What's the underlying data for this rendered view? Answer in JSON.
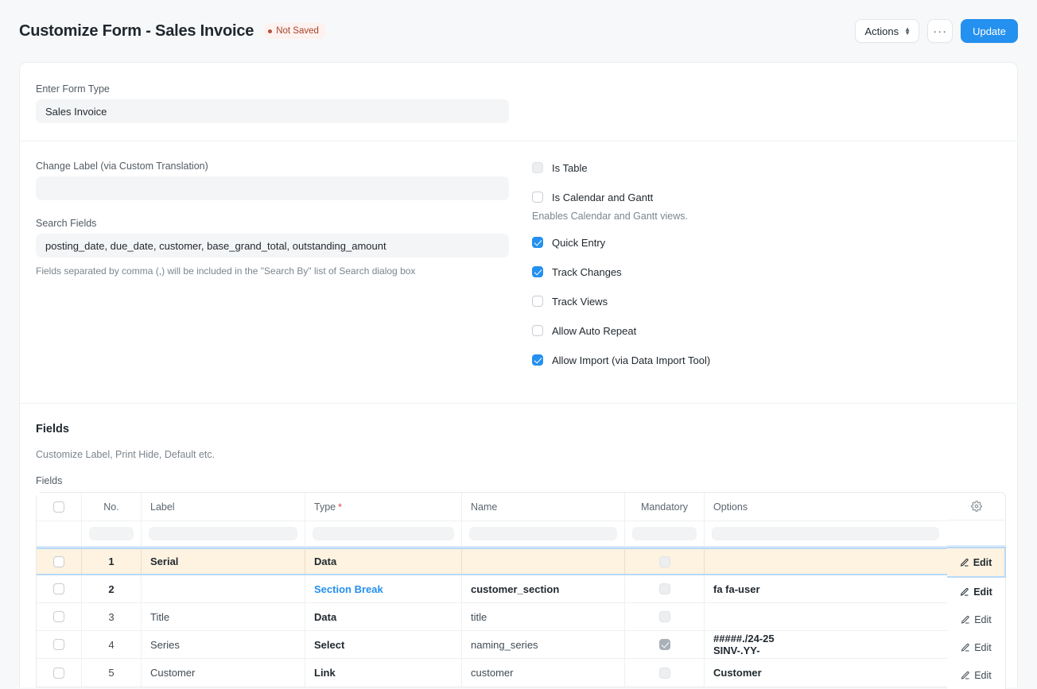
{
  "header": {
    "title": "Customize Form - Sales Invoice",
    "status_badge": "Not Saved",
    "actions_label": "Actions",
    "more_label": "···",
    "primary_label": "Update",
    "accent_color": "#2490ef",
    "badge_bg": "#fdf2ef",
    "badge_fg": "#a8432d"
  },
  "form": {
    "form_type_label": "Enter Form Type",
    "form_type_value": "Sales Invoice",
    "change_label_label": "Change Label (via Custom Translation)",
    "change_label_value": "",
    "search_fields_label": "Search Fields",
    "search_fields_value": "posting_date, due_date, customer, base_grand_total, outstanding_amount",
    "search_fields_help": "Fields separated by comma (,) will be included in the \"Search By\" list of Search dialog box"
  },
  "options": [
    {
      "label": "Is Table",
      "checked": false,
      "disabled": true,
      "help": ""
    },
    {
      "label": "Is Calendar and Gantt",
      "checked": false,
      "disabled": false,
      "help": "Enables Calendar and Gantt views."
    },
    {
      "label": "Quick Entry",
      "checked": true,
      "disabled": false,
      "help": ""
    },
    {
      "label": "Track Changes",
      "checked": true,
      "disabled": false,
      "help": ""
    },
    {
      "label": "Track Views",
      "checked": false,
      "disabled": false,
      "help": ""
    },
    {
      "label": "Allow Auto Repeat",
      "checked": false,
      "disabled": false,
      "help": ""
    },
    {
      "label": "Allow Import (via Data Import Tool)",
      "checked": true,
      "disabled": false,
      "help": ""
    }
  ],
  "fields_section": {
    "title": "Fields",
    "subtitle": "Customize Label, Print Hide, Default etc.",
    "grid_label": "Fields"
  },
  "grid": {
    "columns": {
      "no": "No.",
      "label": "Label",
      "type": "Type",
      "type_required": "*",
      "name": "Name",
      "mandatory": "Mandatory",
      "options": "Options"
    },
    "edit_label": "Edit",
    "rows": [
      {
        "no": "1",
        "label": "Serial",
        "type": "Data",
        "name": "",
        "mandatory": false,
        "options": "",
        "options2": "",
        "selected": true,
        "type_is_link": false
      },
      {
        "no": "2",
        "label": "",
        "type": "Section Break",
        "name": "customer_section",
        "mandatory": false,
        "options": "fa fa-user",
        "options2": "",
        "selected": false,
        "type_is_link": true
      },
      {
        "no": "3",
        "label": "Title",
        "type": "Data",
        "name": "title",
        "mandatory": false,
        "options": "",
        "options2": "",
        "selected": false,
        "type_is_link": false
      },
      {
        "no": "4",
        "label": "Series",
        "type": "Select",
        "name": "naming_series",
        "mandatory": true,
        "options": "#####./24-25",
        "options2": "SINV-.YY-",
        "selected": false,
        "type_is_link": false
      },
      {
        "no": "5",
        "label": "Customer",
        "type": "Link",
        "name": "customer",
        "mandatory": false,
        "options": "Customer",
        "options2": "",
        "selected": false,
        "type_is_link": false
      }
    ]
  }
}
